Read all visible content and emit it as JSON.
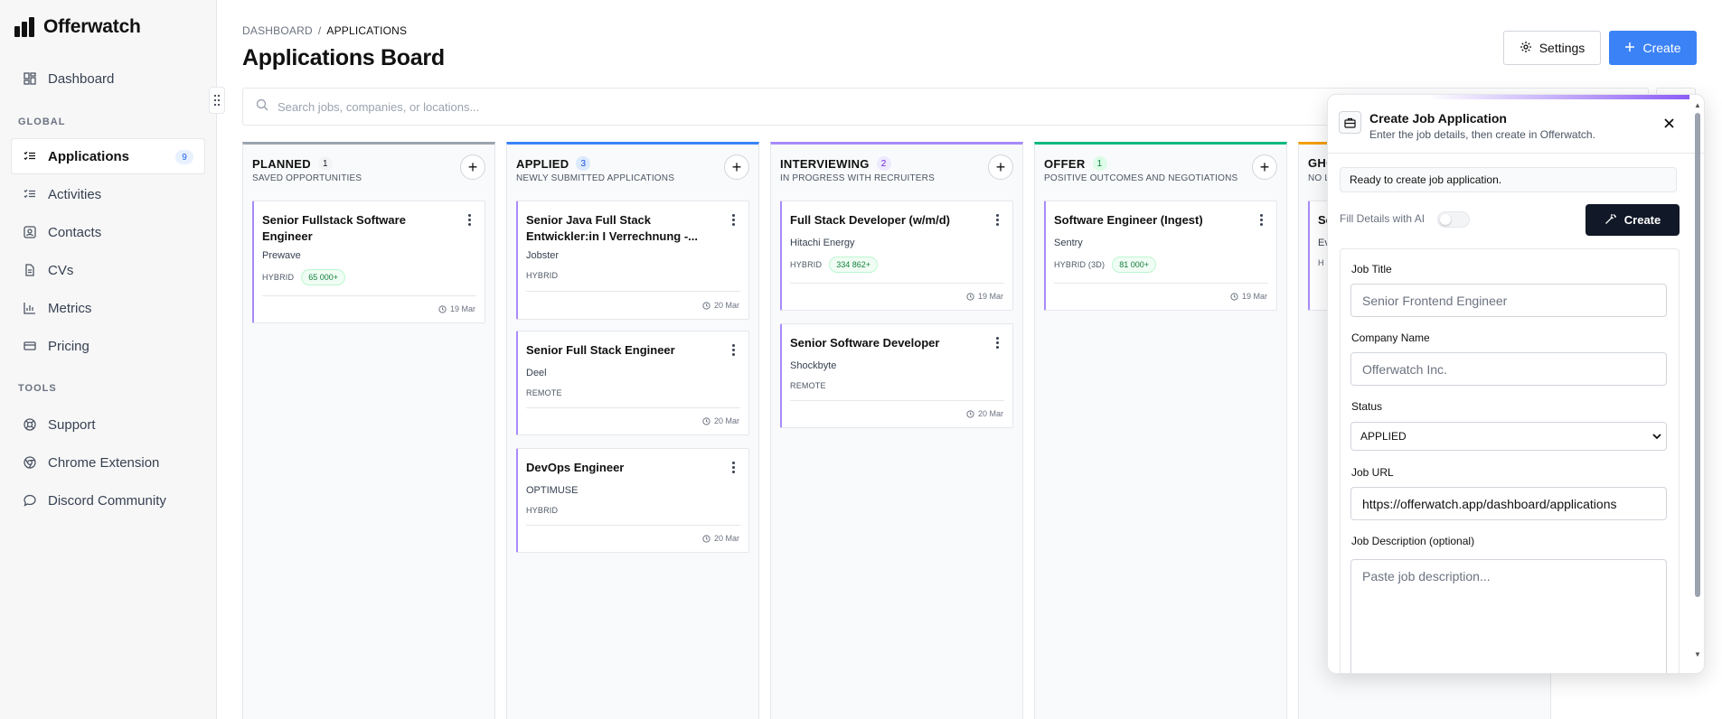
{
  "app": {
    "name": "Offerwatch"
  },
  "sidebar": {
    "top_items": [
      {
        "label": "Dashboard",
        "icon": "dashboard-icon"
      }
    ],
    "global_label": "GLOBAL",
    "global_items": [
      {
        "label": "Applications",
        "icon": "list-icon",
        "badge": "9",
        "active": true
      },
      {
        "label": "Activities",
        "icon": "list-icon"
      },
      {
        "label": "Contacts",
        "icon": "contact-card-icon"
      },
      {
        "label": "CVs",
        "icon": "document-icon"
      },
      {
        "label": "Metrics",
        "icon": "bar-chart-icon"
      },
      {
        "label": "Pricing",
        "icon": "credit-card-icon"
      }
    ],
    "tools_label": "TOOLS",
    "tools_items": [
      {
        "label": "Support",
        "icon": "lifebuoy-icon"
      },
      {
        "label": "Chrome Extension",
        "icon": "chrome-icon"
      },
      {
        "label": "Discord Community",
        "icon": "chat-bubble-icon"
      }
    ]
  },
  "header": {
    "breadcrumb": [
      "DASHBOARD",
      "/",
      "APPLICATIONS"
    ],
    "title": "Applications Board",
    "settings_label": "Settings",
    "create_label": "Create"
  },
  "search": {
    "placeholder": "Search jobs, companies, or locations..."
  },
  "columns": [
    {
      "title": "PLANNED",
      "count": "1",
      "subtitle": "SAVED OPPORTUNITIES",
      "color": "#9ca3af",
      "badge_bg": "#f3f4f6",
      "badge_fg": "#111827",
      "cards": [
        {
          "title": "Senior Fullstack Software Engineer",
          "company": "Prewave",
          "location": "HYBRID",
          "salary": "65 000+",
          "date": "19 Mar"
        }
      ]
    },
    {
      "title": "APPLIED",
      "count": "3",
      "subtitle": "NEWLY SUBMITTED APPLICATIONS",
      "color": "#3b82f6",
      "badge_bg": "#dbeafe",
      "badge_fg": "#1d4ed8",
      "cards": [
        {
          "title": "Senior Java Full Stack Entwickler:in I Verrechnung -...",
          "company": "Jobster",
          "location": "HYBRID",
          "salary": "",
          "date": "20 Mar"
        },
        {
          "title": "Senior Full Stack Engineer",
          "company": "Deel",
          "location": "REMOTE",
          "salary": "",
          "date": "20 Mar"
        },
        {
          "title": "DevOps Engineer",
          "company": "OPTIMUSE",
          "location": "HYBRID",
          "salary": "",
          "date": "20 Mar"
        }
      ]
    },
    {
      "title": "INTERVIEWING",
      "count": "2",
      "subtitle": "IN PROGRESS WITH RECRUITERS",
      "color": "#a78bfa",
      "badge_bg": "#ede9fe",
      "badge_fg": "#6d28d9",
      "cards": [
        {
          "title": "Full Stack Developer (w/m/d)",
          "company": "Hitachi Energy",
          "location": "HYBRID",
          "salary": "334 862+",
          "date": "19 Mar"
        },
        {
          "title": "Senior Software Developer",
          "company": "Shockbyte",
          "location": "REMOTE",
          "salary": "",
          "date": "20 Mar"
        }
      ]
    },
    {
      "title": "OFFER",
      "count": "1",
      "subtitle": "POSITIVE OUTCOMES AND NEGOTIATIONS",
      "color": "#10b981",
      "badge_bg": "#dcfce7",
      "badge_fg": "#15803d",
      "cards": [
        {
          "title": "Software Engineer (Ingest)",
          "company": "Sentry",
          "location": "HYBRID (3D)",
          "salary": "81 000+",
          "date": "19 Mar"
        }
      ]
    },
    {
      "title": "GHO",
      "count": "",
      "subtitle": "NO L",
      "color": "#f59e0b",
      "badge_bg": "#fef3c7",
      "badge_fg": "#b45309",
      "cards": [
        {
          "title": "Se",
          "company": "Ev",
          "location": "H",
          "salary": "",
          "date": ""
        }
      ]
    }
  ],
  "modal": {
    "title": "Create Job Application",
    "subtitle": "Enter the job details, then create in Offerwatch.",
    "status_text": "Ready to create job application.",
    "ai_label": "Fill Details with AI",
    "ai_enabled": false,
    "create_label": "Create",
    "fields": {
      "job_title_label": "Job Title",
      "job_title_placeholder": "Senior Frontend Engineer",
      "company_label": "Company Name",
      "company_placeholder": "Offerwatch Inc.",
      "status_label": "Status",
      "status_value": "APPLIED",
      "url_label": "Job URL",
      "url_value": "https://offerwatch.app/dashboard/applications",
      "description_label": "Job Description (optional)",
      "description_placeholder": "Paste job description..."
    }
  }
}
